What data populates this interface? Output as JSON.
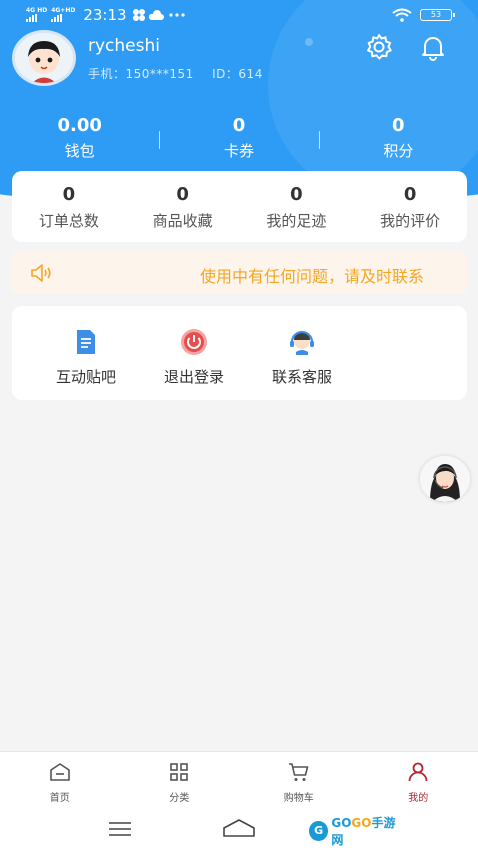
{
  "status_bar": {
    "time": "23:13",
    "signal1_label": "4G HD",
    "signal2_label": "4G+HD",
    "battery": "53",
    "icons": [
      "signal-icon",
      "weather-icon",
      "more-dots-icon",
      "wifi-icon",
      "battery-icon"
    ]
  },
  "user": {
    "name": "rycheshi",
    "phone": "手机：150***151",
    "id": "ID：614"
  },
  "header_icons": [
    "settings-icon",
    "bell-icon"
  ],
  "stats": [
    {
      "value": "0.00",
      "label": "钱包"
    },
    {
      "value": "0",
      "label": "卡券"
    },
    {
      "value": "0",
      "label": "积分"
    }
  ],
  "orders": [
    {
      "value": "0",
      "label": "订单总数"
    },
    {
      "value": "0",
      "label": "商品收藏"
    },
    {
      "value": "0",
      "label": "我的足迹"
    },
    {
      "value": "0",
      "label": "我的评价"
    }
  ],
  "notice": {
    "text": "使用中有任何问题，请及时联系"
  },
  "tools": [
    {
      "label": "互动贴吧",
      "icon": "document-icon"
    },
    {
      "label": "退出登录",
      "icon": "power-icon"
    },
    {
      "label": "联系客服",
      "icon": "headset-icon"
    }
  ],
  "tabbar": [
    {
      "label": "首页",
      "icon": "home-icon"
    },
    {
      "label": "分类",
      "icon": "grid-icon"
    },
    {
      "label": "购物车",
      "icon": "cart-icon"
    },
    {
      "label": "我的",
      "icon": "user-icon"
    }
  ],
  "colors": {
    "header_blue": "#2e9cf5",
    "notice_orange": "#f5a623",
    "active_tab": "#b32531"
  },
  "watermark": {
    "logo_letter": "G",
    "brand_go1": "GO",
    "brand_go2": "GO",
    "brand_suffix": "手游网"
  }
}
